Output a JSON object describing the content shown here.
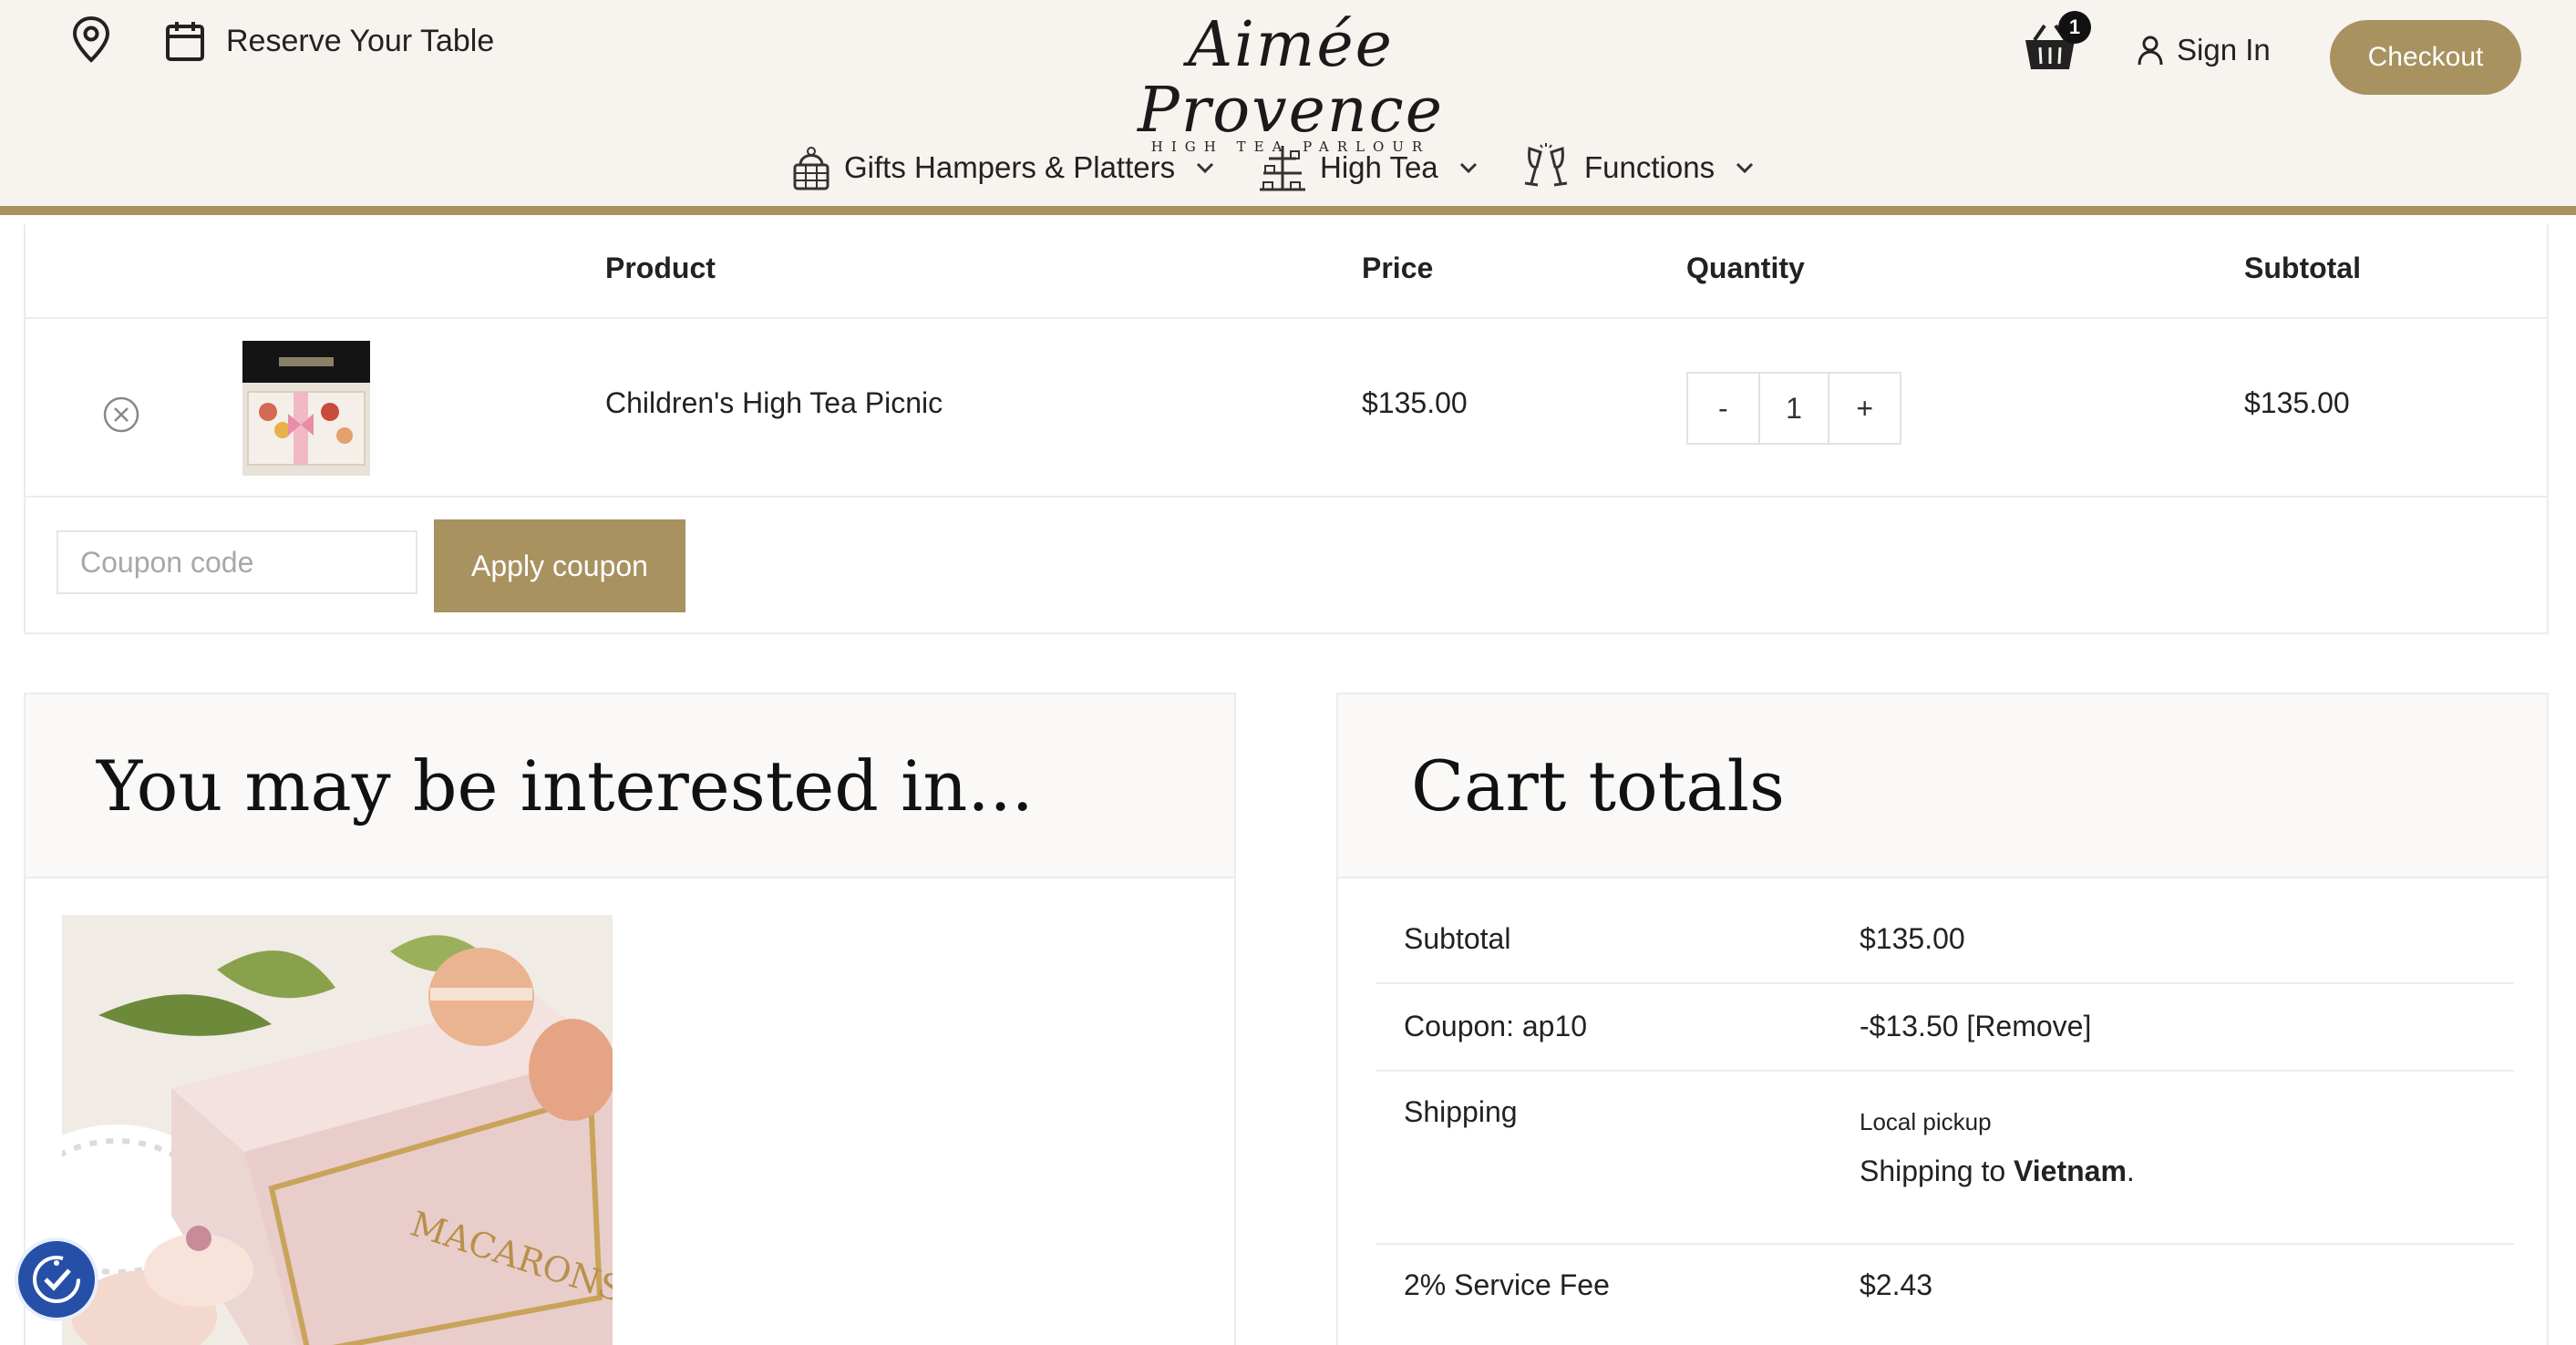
{
  "header": {
    "reserve_label": "Reserve Your Table",
    "logo_script": "Aimée Provence",
    "logo_sub": "HIGH TEA PARLOUR",
    "cart_count": "1",
    "signin_label": "Sign In",
    "checkout_label": "Checkout",
    "accent_color": "#a89260"
  },
  "nav": {
    "items": [
      {
        "label": "Gifts Hampers & Platters",
        "icon": "basket-icon"
      },
      {
        "label": "High Tea",
        "icon": "tea-stand-icon"
      },
      {
        "label": "Functions",
        "icon": "champagne-glasses-icon"
      }
    ]
  },
  "cart": {
    "columns": [
      "Product",
      "Price",
      "Quantity",
      "Subtotal"
    ],
    "rows": [
      {
        "name": "Children's High Tea Picnic",
        "price": "$135.00",
        "quantity": "1",
        "subtotal": "$135.00"
      }
    ],
    "qty_minus": "-",
    "qty_plus": "+",
    "coupon_placeholder": "Coupon code",
    "apply_label": "Apply coupon"
  },
  "related": {
    "title": "You may be interested in..."
  },
  "totals": {
    "title": "Cart totals",
    "subtotal_label": "Subtotal",
    "subtotal_value": "$135.00",
    "coupon_label": "Coupon: ap10",
    "coupon_value": "-$13.50",
    "coupon_remove": "[Remove]",
    "shipping_label": "Shipping",
    "shipping_option": "Local pickup",
    "shipping_to_prefix": "Shipping to ",
    "shipping_country": "Vietnam",
    "shipping_to_suffix": ".",
    "fee_label": "2% Service Fee",
    "fee_value": "$2.43"
  }
}
